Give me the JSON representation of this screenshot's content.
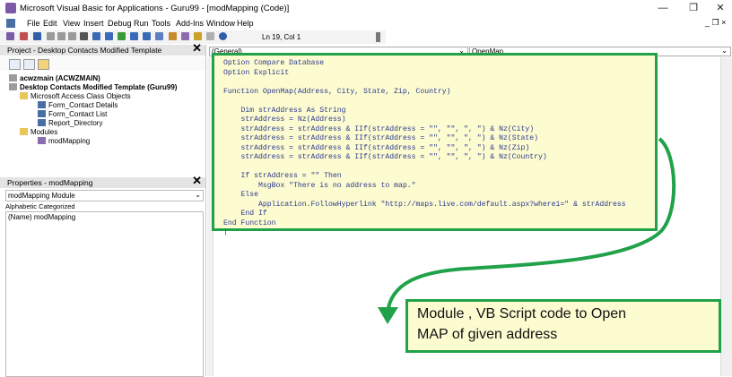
{
  "window": {
    "title": "Microsoft Visual Basic for Applications - Guru99 - [modMapping (Code)]",
    "controls": [
      "—",
      "❐",
      "✕"
    ]
  },
  "menubar": {
    "items": [
      "File",
      "Edit",
      "View",
      "Insert",
      "Debug",
      "Run",
      "Tools",
      "Add-Ins",
      "Window",
      "Help"
    ],
    "mdi_controls": "_ ❐ ×"
  },
  "toolbar": {
    "cursor_position": "Ln 19, Col 1"
  },
  "project_pane": {
    "title": "Project - Desktop Contacts Modified Template",
    "tree": [
      {
        "label": "acwzmain (ACWZMAIN)",
        "bold": true
      },
      {
        "label": "Desktop Contacts Modified Template (Guru99)",
        "bold": true
      },
      {
        "label": "Microsoft Access Class Objects",
        "bold": false
      },
      {
        "label": "Form_Contact Details",
        "bold": false
      },
      {
        "label": "Form_Contact List",
        "bold": false
      },
      {
        "label": "Report_Directory",
        "bold": false
      },
      {
        "label": "Modules",
        "bold": false
      },
      {
        "label": "modMapping",
        "bold": false
      }
    ]
  },
  "properties_pane": {
    "title": "Properties - modMapping",
    "object": "modMapping Module",
    "tabs": [
      "Alphabetic",
      "Categorized"
    ],
    "row": "(Name) modMapping"
  },
  "code_window": {
    "object_combo": "(General)",
    "procedure_combo": "OpenMap",
    "code": "Option Compare Database\nOption Explicit\n\nFunction OpenMap(Address, City, State, Zip, Country)\n\n    Dim strAddress As String\n    strAddress = Nz(Address)\n    strAddress = strAddress & IIf(strAddress = \"\", \"\", \", \") & Nz(City)\n    strAddress = strAddress & IIf(strAddress = \"\", \"\", \", \") & Nz(State)\n    strAddress = strAddress & IIf(strAddress = \"\", \"\", \", \") & Nz(Zip)\n    strAddress = strAddress & IIf(strAddress = \"\", \"\", \", \") & Nz(Country)\n\n    If strAddress = \"\" Then\n        MsgBox \"There is no address to map.\"\n    Else\n        Application.FollowHyperlink \"http://maps.live.com/default.aspx?where1=\" & strAddress\n    End If\nEnd Function\n|"
  },
  "callout": {
    "line1": "Module , VB Script code to Open",
    "line2": "MAP of given address"
  },
  "colors": {
    "highlight_border": "#21a24a",
    "highlight_fill": "#fdfbd0",
    "code_text": "#2b3a8f"
  }
}
